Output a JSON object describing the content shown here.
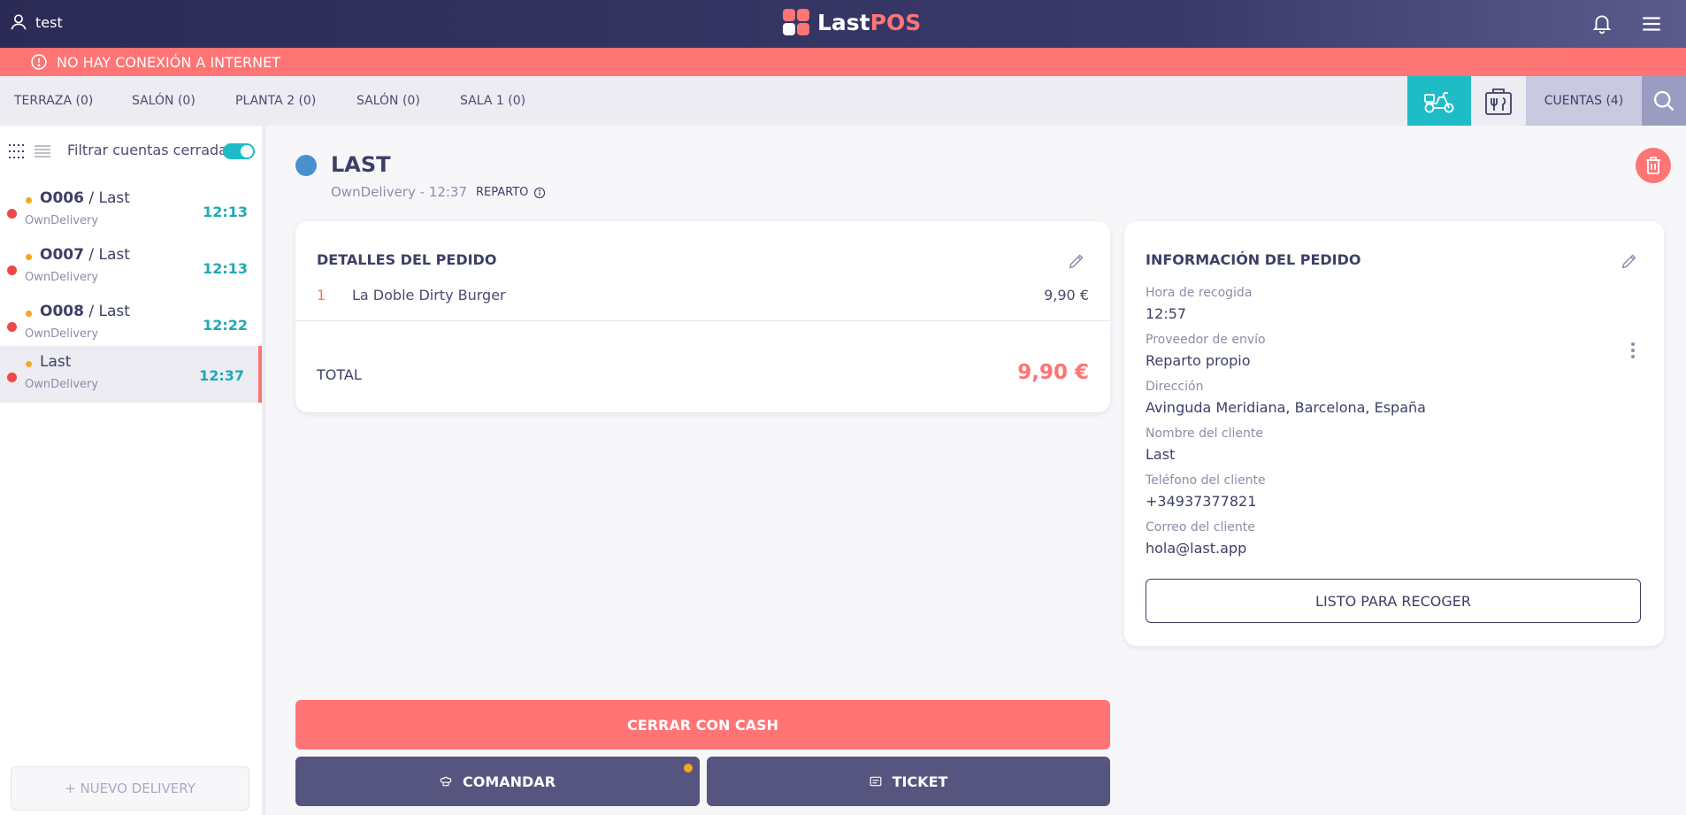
{
  "header": {
    "user_name": "test",
    "brand_left": "Last",
    "brand_right": "POS"
  },
  "alert": {
    "text": "NO HAY CONEXIÓN A INTERNET"
  },
  "rooms": [
    "TERRAZA (0)",
    "SALÓN (0)",
    "PLANTA 2 (0)",
    "SALÓN (0)",
    "SALA 1 (0)"
  ],
  "accounts_button": "CUENTAS (4)",
  "sidebar": {
    "filter_label": "Filtrar cuentas cerradas",
    "filter_on": true,
    "accounts": [
      {
        "code": "O006",
        "name": " / Last",
        "source": "OwnDelivery",
        "time": "12:13",
        "active": false
      },
      {
        "code": "O007",
        "name": " / Last",
        "source": "OwnDelivery",
        "time": "12:13",
        "active": false
      },
      {
        "code": "O008",
        "name": " / Last",
        "source": "OwnDelivery",
        "time": "12:22",
        "active": false
      },
      {
        "code": "",
        "name": "Last",
        "source": "OwnDelivery",
        "time": "12:37",
        "active": true
      }
    ],
    "new_delivery": "+ NUEVO DELIVERY"
  },
  "order": {
    "title": "LAST",
    "meta": "OwnDelivery - 12:37",
    "type": "REPARTO"
  },
  "details": {
    "heading": "DETALLES DEL PEDIDO",
    "line": {
      "qty": "1",
      "name": "La Doble Dirty Burger",
      "price": "9,90 €"
    },
    "total_label": "TOTAL",
    "total_value": "9,90 €"
  },
  "info": {
    "heading": "INFORMACIÓN DEL PEDIDO",
    "pickup_label": "Hora de recogida",
    "pickup_value": "12:57",
    "provider_label": "Proveedor de envío",
    "provider_value": "Reparto propio",
    "address_label": "Dirección",
    "address_value": "Avinguda Meridiana, Barcelona, España",
    "name_label": "Nombre del cliente",
    "name_value": "Last",
    "phone_label": "Teléfono del cliente",
    "phone_value": "+34937377821",
    "email_label": "Correo del cliente",
    "email_value": "hola@last.app",
    "ready_button": "LISTO PARA RECOGER"
  },
  "actions": {
    "cash": "CERRAR CON CASH",
    "comandar": "COMANDAR",
    "ticket": "TICKET"
  },
  "colors": {
    "accent": "#ff7474",
    "teal": "#1fbcc7",
    "navy": "#56557f"
  }
}
